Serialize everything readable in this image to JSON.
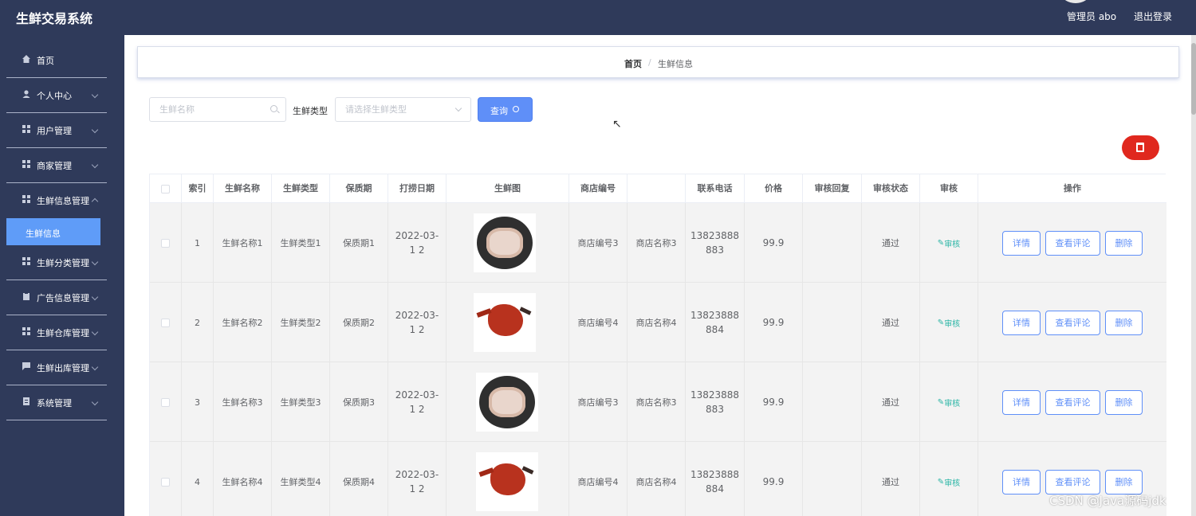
{
  "header": {
    "app_title": "生鲜交易系统",
    "user_label": "管理员 abo",
    "logout_label": "退出登录"
  },
  "sidebar": {
    "items": [
      {
        "label": "首页",
        "icon": "home-icon"
      },
      {
        "label": "个人中心",
        "icon": "user-icon"
      },
      {
        "label": "用户管理",
        "icon": "grid-icon"
      },
      {
        "label": "商家管理",
        "icon": "grid-icon"
      },
      {
        "label": "生鲜信息管理",
        "icon": "grid-icon"
      },
      {
        "label": "生鲜分类管理",
        "icon": "grid-icon"
      },
      {
        "label": "广告信息管理",
        "icon": "clipboard-icon"
      },
      {
        "label": "生鲜仓库管理",
        "icon": "grid-icon"
      },
      {
        "label": "生鲜出库管理",
        "icon": "chat-icon"
      },
      {
        "label": "系统管理",
        "icon": "doc-icon"
      }
    ],
    "active_sub": "生鲜信息"
  },
  "breadcrumb": {
    "home": "首页",
    "separator": "/",
    "current": "生鲜信息"
  },
  "search": {
    "name_placeholder": "生鲜名称",
    "type_label": "生鲜类型",
    "type_placeholder": "请选择生鲜类型",
    "query_label": "查询"
  },
  "colors": {
    "sidebar_bg": "#2f3a5a",
    "accent": "#5f8ff8",
    "danger": "#e0281e",
    "audit": "#2ab5a5"
  },
  "table": {
    "columns": [
      "",
      "索引",
      "生鲜名称",
      "生鲜类型",
      "保质期",
      "打捞日期",
      "生鲜图",
      "商店编号",
      "",
      "联系电话",
      "价格",
      "审核回复",
      "审核状态",
      "审核",
      "操作"
    ],
    "rows": [
      {
        "index": "1",
        "name": "生鲜名称1",
        "type": "生鲜类型1",
        "shelf": "保质期1",
        "date": "2022-03-1 2",
        "image": "shrimp",
        "shop_no": "商店编号3",
        "shop_name": "商店名称3",
        "phone": "13823888 883",
        "price": "99.9",
        "reply": "",
        "status": "通过",
        "audit": "审核"
      },
      {
        "index": "2",
        "name": "生鲜名称2",
        "type": "生鲜类型2",
        "shelf": "保质期2",
        "date": "2022-03-1 2",
        "image": "crayfish",
        "shop_no": "商店编号4",
        "shop_name": "商店名称4",
        "phone": "13823888 884",
        "price": "99.9",
        "reply": "",
        "status": "通过",
        "audit": "审核"
      },
      {
        "index": "3",
        "name": "生鲜名称3",
        "type": "生鲜类型3",
        "shelf": "保质期3",
        "date": "2022-03-1 2",
        "image": "shrimp",
        "shop_no": "商店编号3",
        "shop_name": "商店名称3",
        "phone": "13823888 883",
        "price": "99.9",
        "reply": "",
        "status": "通过",
        "audit": "审核"
      },
      {
        "index": "4",
        "name": "生鲜名称4",
        "type": "生鲜类型4",
        "shelf": "保质期4",
        "date": "2022-03-1 2",
        "image": "crayfish",
        "shop_no": "商店编号4",
        "shop_name": "商店名称4",
        "phone": "13823888 884",
        "price": "99.9",
        "reply": "",
        "status": "通过",
        "audit": "审核"
      }
    ],
    "actions": {
      "detail": "详情",
      "comments": "查看评论",
      "delete": "删除"
    }
  },
  "watermark": "CSDN @Java源码jdk"
}
